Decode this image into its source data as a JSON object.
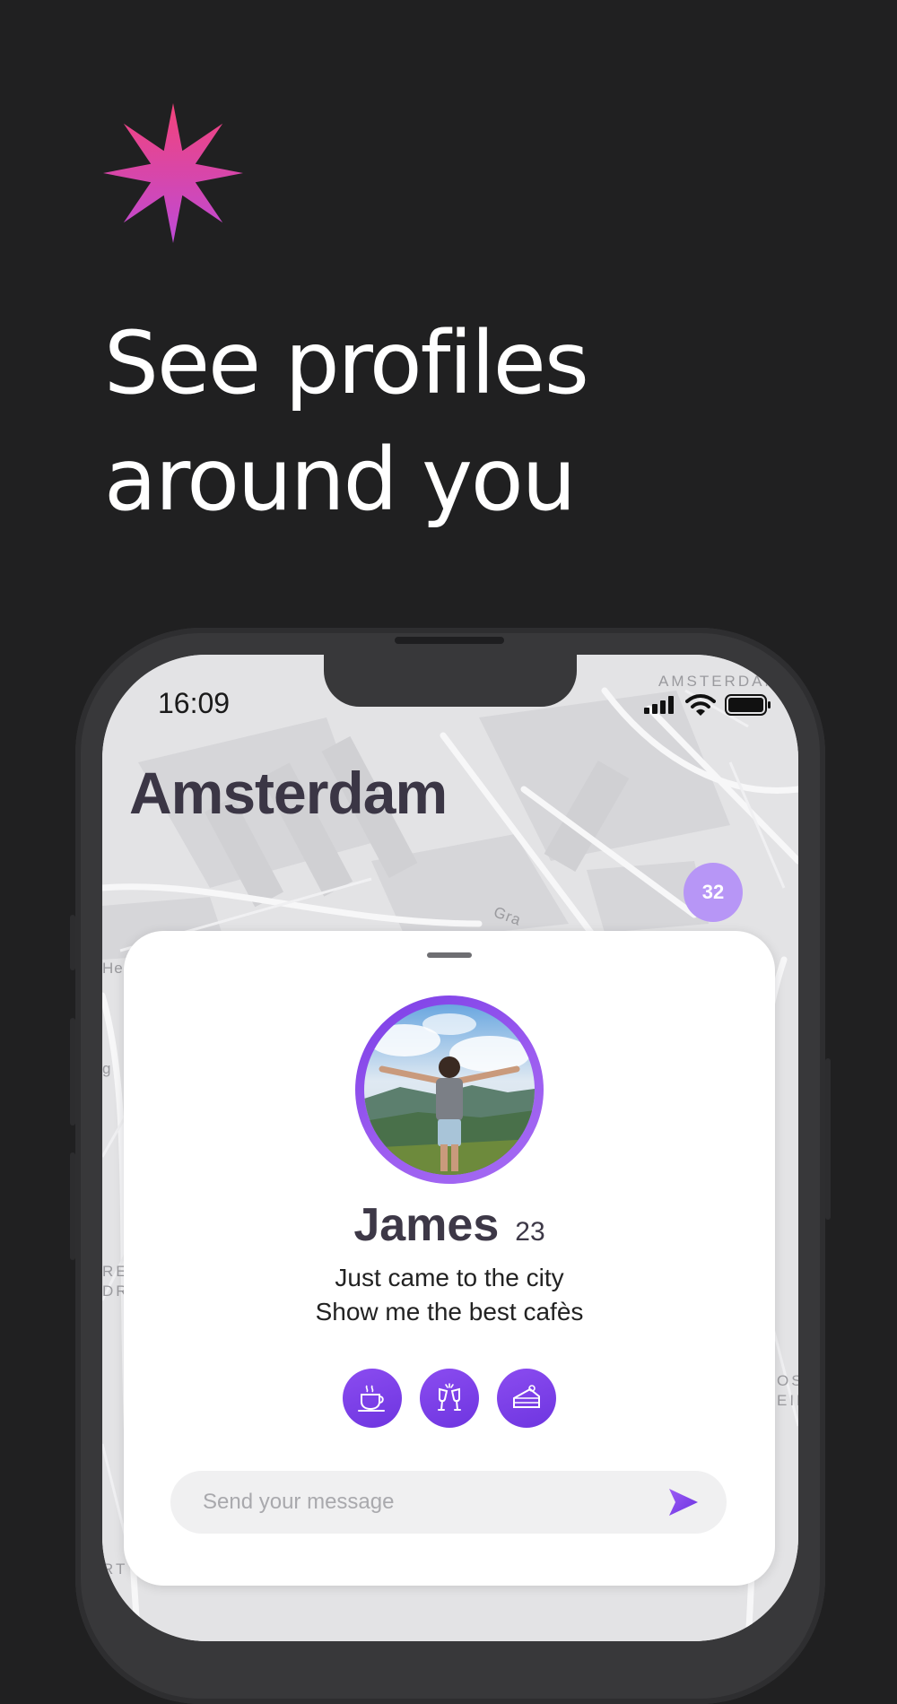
{
  "headline": {
    "line1": "See profiles",
    "line2": "around you"
  },
  "phone": {
    "status": {
      "time": "16:09"
    },
    "map_labels": {
      "top_right": "AMSTERDAM",
      "left_1": "He",
      "left_2": "g",
      "left_3": "RE",
      "left_4": "DR",
      "left_5": "RT",
      "right_1": "OS",
      "right_2": "EIL",
      "street": "Gra"
    },
    "city": "Amsterdam",
    "nearby_count": "32"
  },
  "profile": {
    "name": "James",
    "age": "23",
    "bio_line1": "Just came to the city",
    "bio_line2": "Show me the best cafès",
    "interests": [
      "coffee-icon",
      "cheers-icon",
      "cake-icon"
    ]
  },
  "message": {
    "placeholder": "Send your message"
  },
  "colors": {
    "accent": "#7b3ee6",
    "badge": "#b796f6",
    "star_top": "#f0407a",
    "star_bottom": "#c04ad6"
  }
}
